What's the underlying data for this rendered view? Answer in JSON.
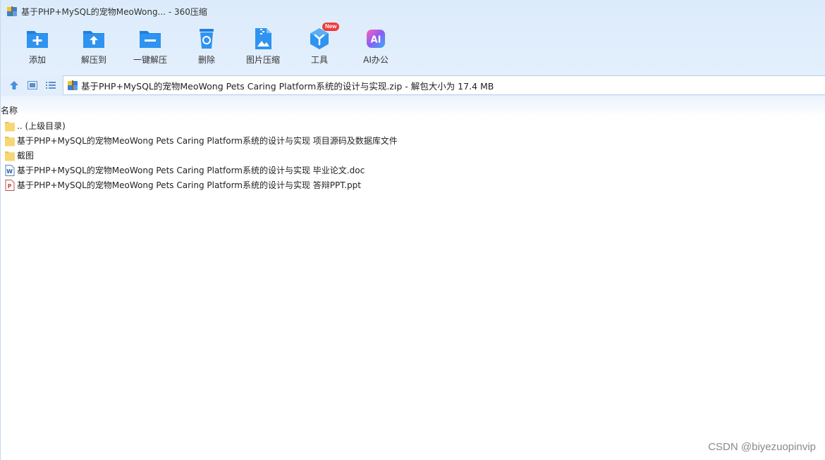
{
  "window": {
    "title": "基于PHP+MySQL的宠物MeoWong... - 360压缩"
  },
  "toolbar": {
    "items": [
      {
        "label": "添加",
        "icon": "add-folder-icon"
      },
      {
        "label": "解压到",
        "icon": "extract-to-icon"
      },
      {
        "label": "一键解压",
        "icon": "one-click-extract-icon"
      },
      {
        "label": "删除",
        "icon": "recycle-bin-icon"
      },
      {
        "label": "图片压缩",
        "icon": "image-compress-icon"
      },
      {
        "label": "工具",
        "icon": "tools-icon",
        "badge": "New"
      },
      {
        "label": "AI办公",
        "icon": "ai-office-icon"
      }
    ]
  },
  "address": {
    "text": "基于PHP+MySQL的宠物MeoWong Pets Caring Platform系统的设计与实现.zip - 解包大小为 17.4 MB"
  },
  "list": {
    "column_name": "名称",
    "items": [
      {
        "name": ".. (上级目录)",
        "type": "folder"
      },
      {
        "name": "基于PHP+MySQL的宠物MeoWong Pets Caring Platform系统的设计与实现 项目源码及数据库文件",
        "type": "folder"
      },
      {
        "name": "截图",
        "type": "folder"
      },
      {
        "name": "基于PHP+MySQL的宠物MeoWong Pets Caring Platform系统的设计与实现 毕业论文.doc",
        "type": "word"
      },
      {
        "name": "基于PHP+MySQL的宠物MeoWong Pets Caring Platform系统的设计与实现 答辩PPT.ppt",
        "type": "ppt"
      }
    ]
  },
  "watermark": "CSDN @biyezuopinvip",
  "colors": {
    "accent": "#2b8ae6",
    "chrome_bg": "#dcebfb",
    "folder": "#f7d774",
    "badge": "#ef3b3b"
  }
}
